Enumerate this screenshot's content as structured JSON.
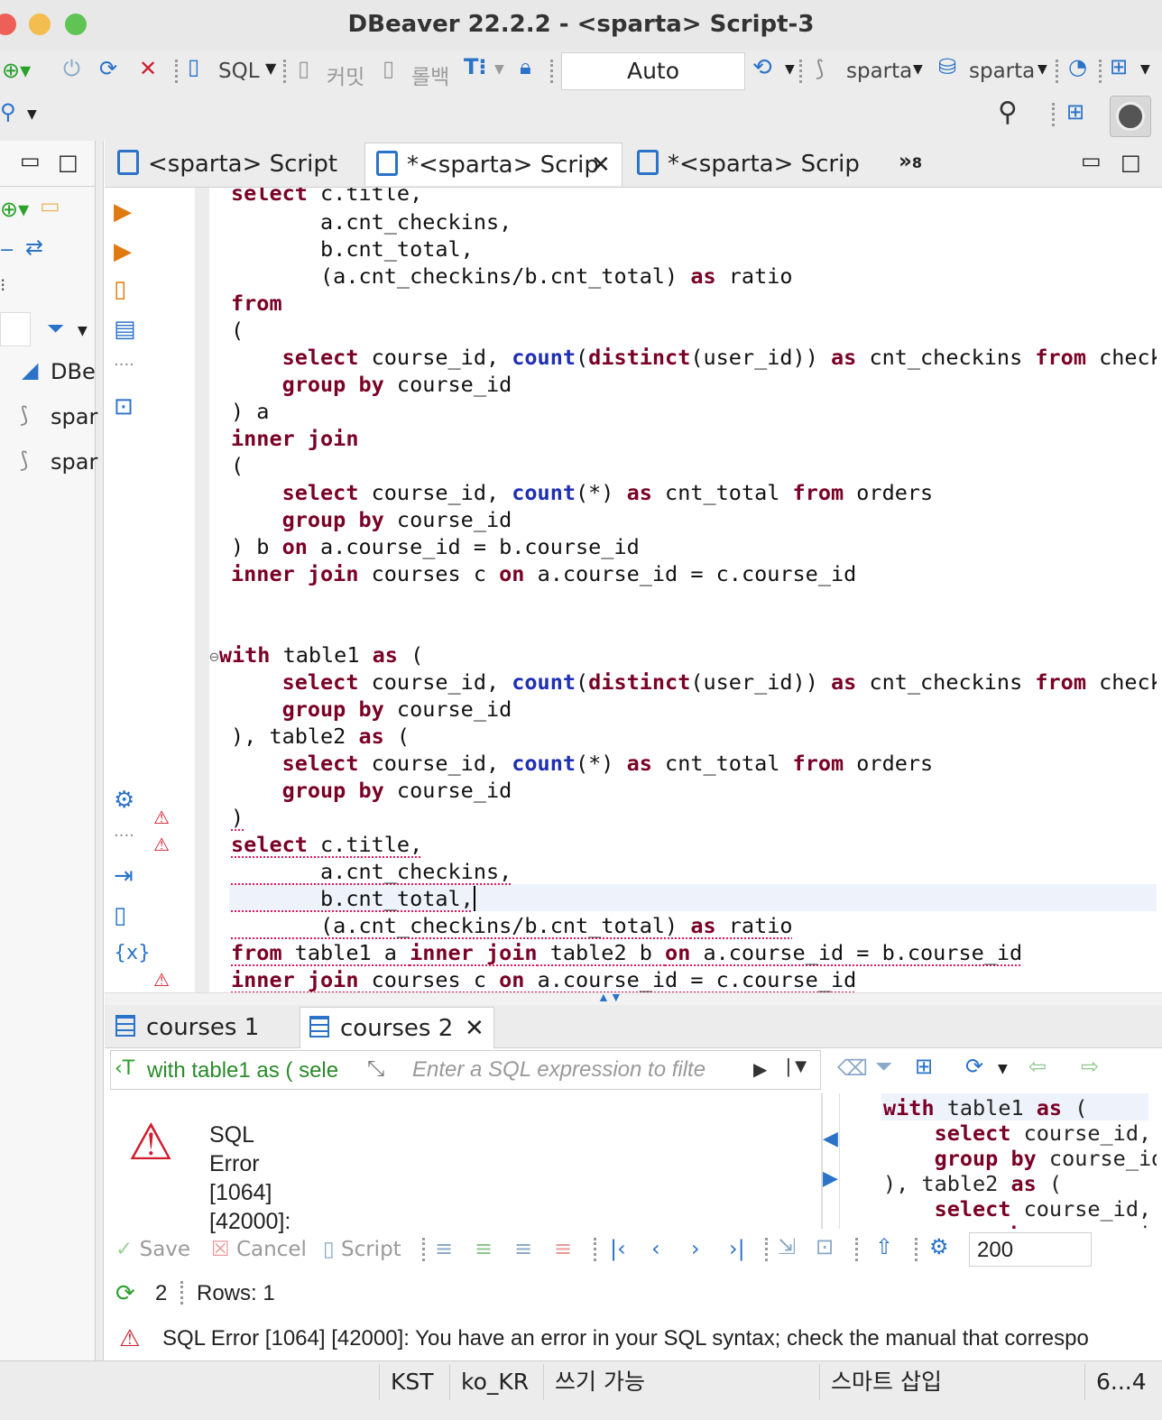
{
  "window": {
    "title": "DBeaver 22.2.2 - <sparta> Script-3"
  },
  "toolbar": {
    "sql_label": "SQL",
    "commit_label": "커밋",
    "rollback_label": "롤백",
    "mode_value": "Auto",
    "datasource_label": "sparta",
    "schema_label": "sparta"
  },
  "left_panel": {
    "items": [
      {
        "label": "DBe",
        "icon": "dbeaver-icon"
      },
      {
        "label": "spar",
        "icon": "mysql-connected-icon"
      },
      {
        "label": "spar",
        "icon": "mysql-icon"
      }
    ]
  },
  "editor_tabs": [
    {
      "label": "<sparta> Script",
      "active": false
    },
    {
      "label": "*<sparta> Scrip",
      "active": true
    },
    {
      "label": "*<sparta> Scrip",
      "active": false
    }
  ],
  "editor_tabs_more": "»",
  "editor_tabs_count": "8",
  "result_tabs": [
    {
      "label": "courses 1",
      "active": false
    },
    {
      "label": "courses 2",
      "active": true
    }
  ],
  "filter": {
    "query_preview": "with table1 as ( sele",
    "placeholder": "Enter a SQL expression to filte"
  },
  "error_pane": {
    "lines": [
      "SQL",
      "Error",
      "[1064]",
      "[42000]:"
    ]
  },
  "results_toolbar": {
    "save_label": "Save",
    "cancel_label": "Cancel",
    "script_label": "Script",
    "fetch_size": "200"
  },
  "status": {
    "refresh_count": "2",
    "rows_label": "Rows: 1",
    "error_message": "SQL Error [1064] [42000]: You have an error in your SQL syntax; check the manual that correspo"
  },
  "status_bar": {
    "timezone": "KST",
    "locale": "ko_KR",
    "write_mode": "쓰기 가능",
    "insert_mode": "스마트 삽입",
    "position": "6...4"
  },
  "colors": {
    "keyword": "#7a0026",
    "function": "#1f2fb5",
    "error": "#d01c2d",
    "accent": "#2a73c8"
  }
}
